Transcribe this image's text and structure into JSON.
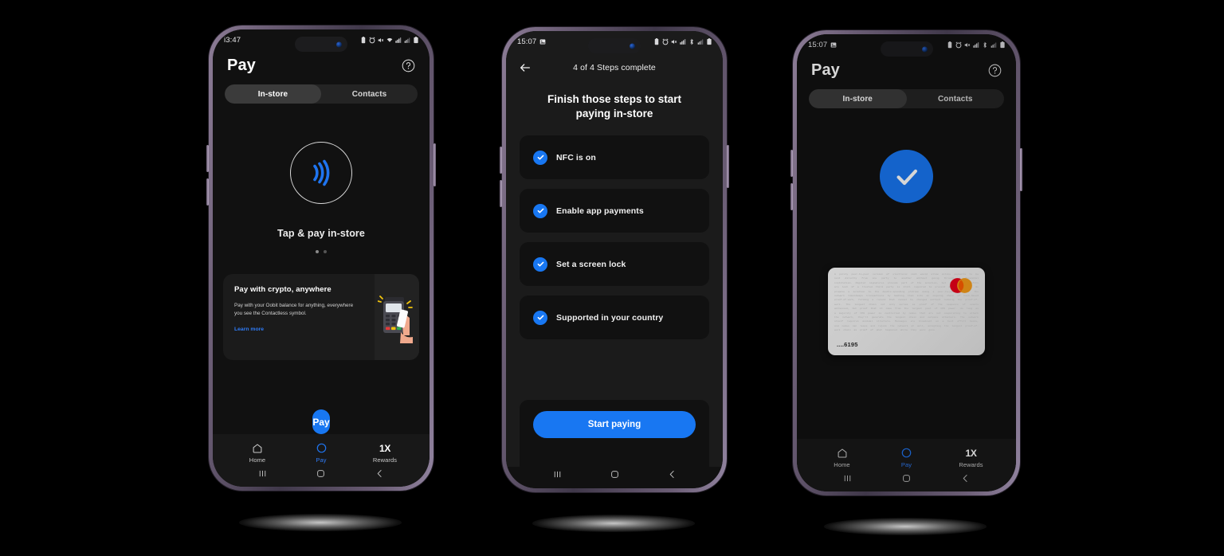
{
  "phones": [
    {
      "id": "phone-1",
      "status": {
        "time": "i3:47",
        "icons": [
          "battery-saver-icon",
          "alarm-icon",
          "mute-icon",
          "wifi-icon",
          "signal-icon",
          "signal-bars-icon",
          "battery-icon"
        ]
      },
      "header": {
        "title": "Pay",
        "help_icon": "help-circle-icon"
      },
      "tabs": [
        {
          "label": "In-store",
          "active": true
        },
        {
          "label": "Contacts",
          "active": false
        }
      ],
      "nfc_icon": "contactless-nfc-icon",
      "tap_label": "Tap & pay in-store",
      "carousel": {
        "total": 2,
        "active": 1
      },
      "promo": {
        "title": "Pay with crypto, anywhere",
        "body": "Pay with your Oobit balance for anything, everywhere you see the Contactless symbol.",
        "link": "Learn more",
        "image": "pos-terminal-phone-tap-illustration"
      },
      "cta": {
        "label": "Pay"
      },
      "tabbar": [
        {
          "label": "Home",
          "icon": "home-icon",
          "selected": false
        },
        {
          "label": "Pay",
          "icon": "circle-icon",
          "selected": true
        },
        {
          "label": "Rewards",
          "icon": "1X",
          "selected": false
        }
      ],
      "navbar": [
        "recents-icon",
        "home-button-icon",
        "back-icon"
      ]
    },
    {
      "id": "phone-2",
      "status": {
        "time": "15:07",
        "icons": [
          "photo-icon",
          "battery-saver-icon",
          "alarm-icon",
          "mute-icon",
          "signal-icon",
          "bluetooth-icon",
          "signal-bars-icon",
          "battery-icon"
        ]
      },
      "topbar": {
        "back_icon": "back-arrow-icon",
        "steps_label": "4 of 4 Steps complete"
      },
      "heading": "Finish those steps to start paying in-store",
      "steps": [
        {
          "label": "NFC is on",
          "done": true
        },
        {
          "label": "Enable app payments",
          "done": true
        },
        {
          "label": "Set a screen lock",
          "done": true
        },
        {
          "label": "Supported in your country",
          "done": true
        }
      ],
      "cta": {
        "label": "Start paying"
      },
      "navbar": [
        "recents-icon",
        "home-button-icon",
        "back-icon"
      ]
    },
    {
      "id": "phone-3",
      "status": {
        "time": "15:07",
        "icons": [
          "photo-icon",
          "battery-saver-icon",
          "alarm-icon",
          "mute-icon",
          "signal-icon",
          "bluetooth-icon",
          "signal-bars-icon",
          "battery-icon"
        ]
      },
      "header": {
        "title": "Pay",
        "help_icon": "help-circle-icon"
      },
      "tabs": [
        {
          "label": "In-store",
          "active": true
        },
        {
          "label": "Contacts",
          "active": false
        }
      ],
      "success_icon": "success-check-icon",
      "card": {
        "number": "....6195",
        "network_logo": "mastercard-logo",
        "background_text": "A purely peer-to-peer version of electronic cash would allow online payments to be sent directly from one party to another without going through a financial institution. Digital signatures provide part of the solution, but the main benefits are lost if a trusted third party is still required to prevent double-spending. We propose a solution to the double-spending problem using a peer-to-peer network. The network timestamps transactions by hashing them into an ongoing chain of hash-based proof-of-work, forming a record that cannot be changed without redoing the proof-of-work. The longest chain not only serves as proof of the sequence of events witnessed, but proof that it came from the largest pool of CPU power. As long as a majority of CPU power is controlled by nodes that are not cooperating to attack the network, they'll generate the longest chain and outpace attackers. The network itself requires minimal structure. Messages are broadcast on a best effort basis, and nodes can leave and rejoin the network at will, accepting the longest proof-of-work chain as proof of what happened while they were gone."
      },
      "tabbar": [
        {
          "label": "Home",
          "icon": "home-icon",
          "selected": false
        },
        {
          "label": "Pay",
          "icon": "circle-icon",
          "selected": true
        },
        {
          "label": "Rewards",
          "icon": "1X",
          "selected": false
        }
      ],
      "navbar": [
        "recents-icon",
        "home-button-icon",
        "back-icon"
      ]
    }
  ],
  "colors": {
    "accent": "#1877f2",
    "link": "#2f7bf6",
    "screen_bg": "#111111",
    "card_bg": "#1b1b1b",
    "frame": "#6d5f77"
  }
}
